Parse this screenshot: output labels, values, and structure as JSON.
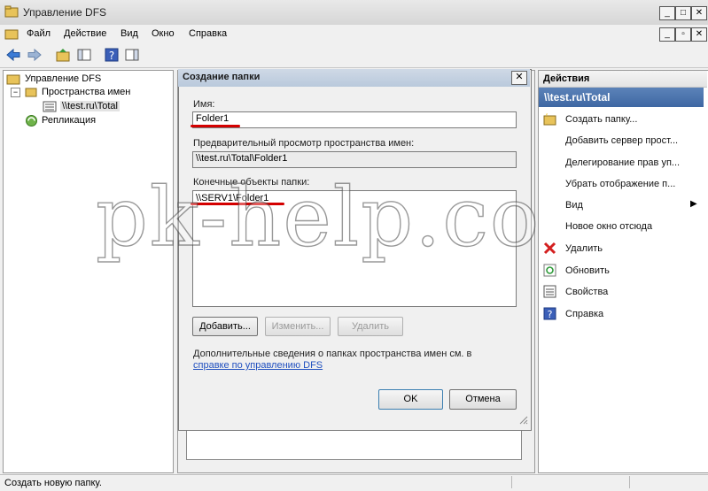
{
  "window": {
    "title": "Управление DFS"
  },
  "menu": [
    "Файл",
    "Действие",
    "Вид",
    "Окно",
    "Справка"
  ],
  "tree": {
    "root": "Управление DFS",
    "namespaces": "Пространства имен",
    "namespace_item": "\\\\test.ru\\Total",
    "replication": "Репликация"
  },
  "dialog": {
    "title": "Создание папки",
    "name_label": "Имя:",
    "name_value": "Folder1",
    "preview_label": "Предварительный просмотр пространства имен:",
    "preview_value": "\\\\test.ru\\Total\\Folder1",
    "targets_label": "Конечные объекты папки:",
    "targets": [
      "\\\\SERV1\\Folder1"
    ],
    "add_button": "Добавить...",
    "edit_button": "Изменить...",
    "remove_button": "Удалить",
    "info_text": "Дополнительные сведения о папках пространства имен см. в",
    "info_link": "справке по управлению DFS",
    "ok_button": "OK",
    "cancel_button": "Отмена"
  },
  "actions": {
    "header": "Действия",
    "subheader": "\\\\test.ru\\Total",
    "items": [
      {
        "label": "Создать папку...",
        "icon": "new-folder-icon"
      },
      {
        "label": "Добавить сервер прост...",
        "icon": ""
      },
      {
        "label": "Делегирование прав уп...",
        "icon": ""
      },
      {
        "label": "Убрать отображение п...",
        "icon": ""
      },
      {
        "label": "Вид",
        "icon": "chevron-right-icon"
      },
      {
        "label": "Новое окно отсюда",
        "icon": ""
      },
      {
        "label": "Удалить",
        "icon": "delete-icon"
      },
      {
        "label": "Обновить",
        "icon": "refresh-icon"
      },
      {
        "label": "Свойства",
        "icon": "properties-icon"
      },
      {
        "label": "Справка",
        "icon": "help-icon"
      }
    ]
  },
  "watermark": "pk-help.com",
  "status": {
    "text": "Создать новую папку."
  }
}
